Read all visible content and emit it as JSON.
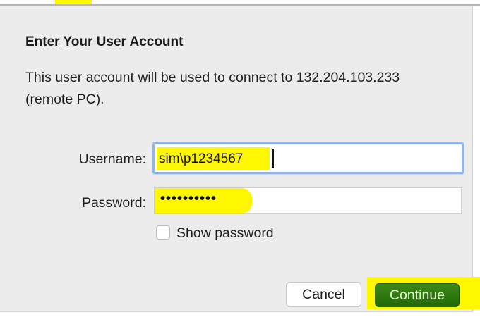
{
  "dialog": {
    "title": "Enter Your User Account",
    "description": "This user account will be used to connect to 132.204.103.233 (remote PC).",
    "username": {
      "label": "Username:",
      "value": "sim\\p1234567"
    },
    "password": {
      "label": "Password:",
      "masked_value": "••••••••••"
    },
    "show_password": {
      "label": "Show password",
      "checked": false
    },
    "buttons": {
      "cancel": "Cancel",
      "continue": "Continue"
    }
  },
  "colors": {
    "highlight": "#fff700",
    "focus_ring": "#92b4e8",
    "continue_button": "#2a7a0e"
  }
}
